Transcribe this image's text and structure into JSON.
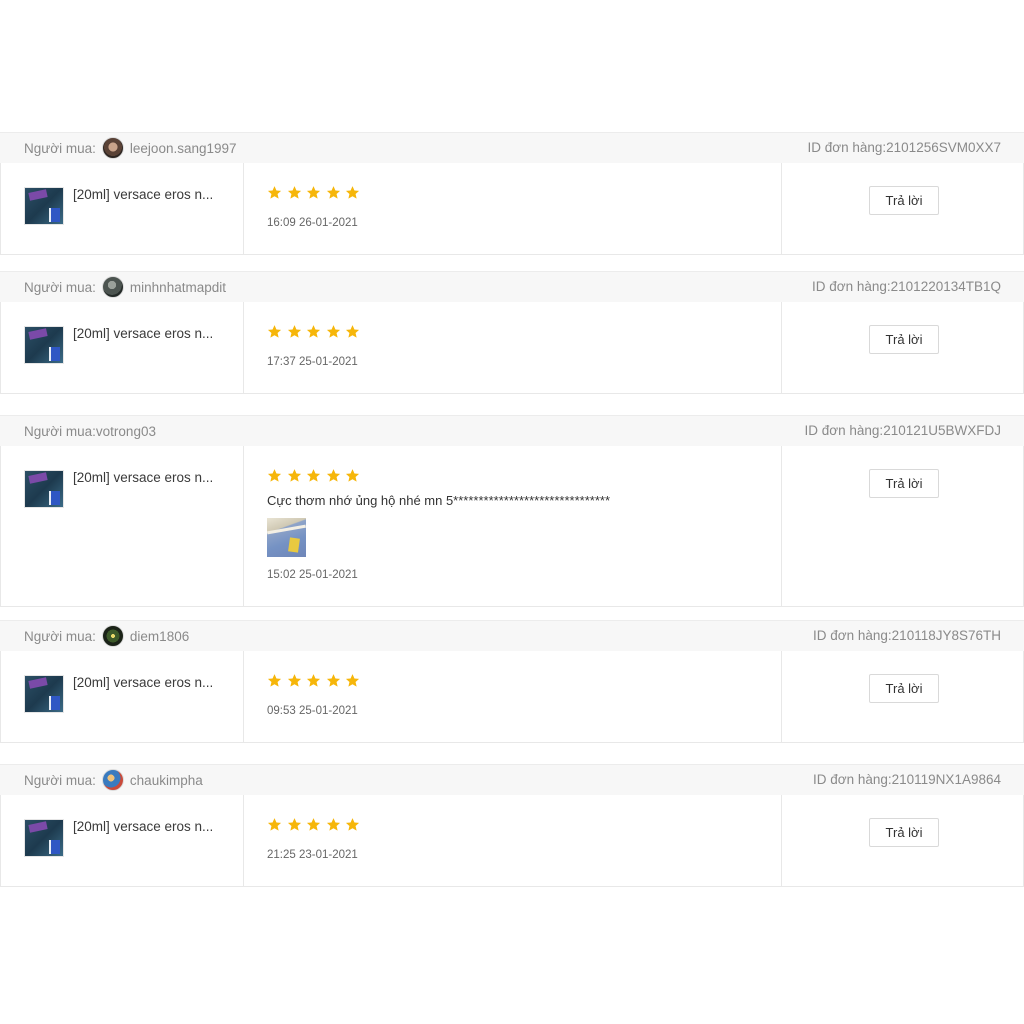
{
  "buyer_label": "Người mua:",
  "reply_label": "Trả lời",
  "order_id_label": "ID đơn hàng:",
  "star_color": "#f6b60a",
  "reviews": [
    {
      "buyer": "leejoon.sang1997",
      "has_avatar": true,
      "order_id": "2101256SVM0XX7",
      "product": "[20ml] versace eros n...",
      "rating": 5,
      "comment": "",
      "has_photo": false,
      "date": "16:09 26-01-2021"
    },
    {
      "buyer": "minhnhatmapdit",
      "has_avatar": true,
      "order_id": "2101220134TB1Q",
      "product": "[20ml] versace eros n...",
      "rating": 5,
      "comment": "",
      "has_photo": false,
      "date": "17:37 25-01-2021"
    },
    {
      "buyer": "votrong03",
      "has_avatar": false,
      "order_id": "210121U5BWXFDJ",
      "product": "[20ml] versace eros n...",
      "rating": 5,
      "comment": "Cực thơm nhớ ủng hộ nhé mn 5*******************************",
      "has_photo": true,
      "date": "15:02 25-01-2021"
    },
    {
      "buyer": "diem1806",
      "has_avatar": true,
      "order_id": "210118JY8S76TH",
      "product": "[20ml] versace eros n...",
      "rating": 5,
      "comment": "",
      "has_photo": false,
      "date": "09:53 25-01-2021"
    },
    {
      "buyer": "chaukimpha",
      "has_avatar": true,
      "order_id": "210119NX1A9864",
      "product": "[20ml] versace eros n...",
      "rating": 5,
      "comment": "",
      "has_photo": false,
      "date": "21:25 23-01-2021"
    }
  ]
}
